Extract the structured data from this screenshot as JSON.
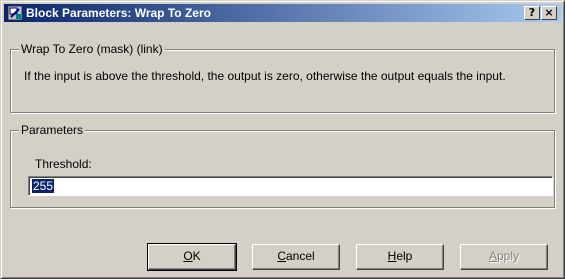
{
  "window": {
    "title": "Block Parameters: Wrap To Zero",
    "help_button": "?",
    "close_button": "×"
  },
  "description_group": {
    "legend": "Wrap To Zero (mask) (link)",
    "text": "If the input is above the threshold, the output is zero, otherwise the output equals the input."
  },
  "parameters_group": {
    "legend": "Parameters",
    "threshold_label": "Threshold:",
    "threshold_value": "255"
  },
  "buttons": {
    "ok_mnemonic": "O",
    "ok_rest": "K",
    "cancel_mnemonic": "C",
    "cancel_rest": "ancel",
    "help_mnemonic": "H",
    "help_rest": "elp",
    "apply_mnemonic": "A",
    "apply_rest": "pply"
  },
  "colors": {
    "title_gradient_start": "#0a246a",
    "title_gradient_end": "#a6caf0",
    "face": "#d4d0c8",
    "selection": "#0a246a"
  }
}
